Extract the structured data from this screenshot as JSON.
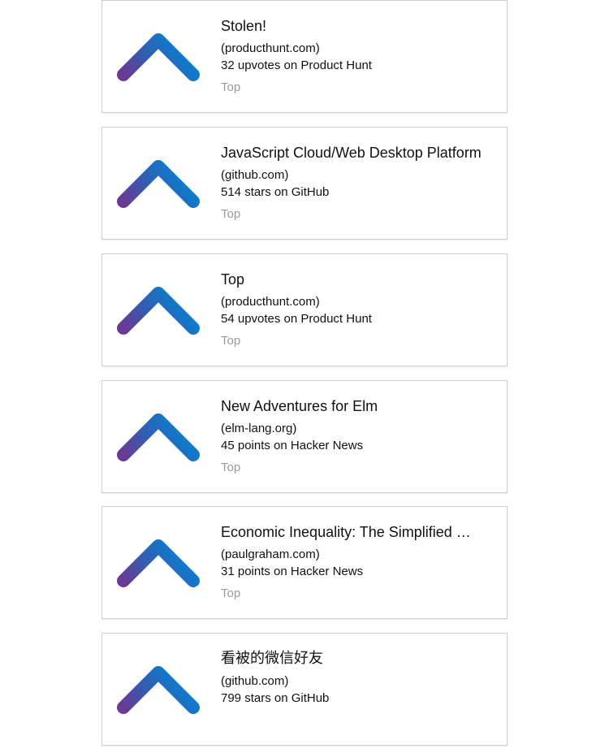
{
  "colors": {
    "arrow_start": "#6a3a94",
    "arrow_mid": "#2f5fb3",
    "arrow_end": "#0a7fd0",
    "card_border": "#cfcfcf",
    "tag_text": "#9a9a9a"
  },
  "icon": "upvote-chevron-icon",
  "items": [
    {
      "title": "Stolen!",
      "domain": "(producthunt.com)",
      "meta": "32 upvotes on Product Hunt",
      "tag": "Top"
    },
    {
      "title": "JavaScript Cloud/Web Desktop Platform",
      "domain": "(github.com)",
      "meta": "514 stars on GitHub",
      "tag": "Top"
    },
    {
      "title": "Top",
      "domain": "(producthunt.com)",
      "meta": "54 upvotes on Product Hunt",
      "tag": "Top"
    },
    {
      "title": "New Adventures for Elm",
      "domain": "(elm-lang.org)",
      "meta": "45 points on Hacker News",
      "tag": "Top"
    },
    {
      "title": "Economic Inequality: The Simplified …",
      "domain": "(paulgraham.com)",
      "meta": "31 points on Hacker News",
      "tag": "Top"
    },
    {
      "title": "看被的微信好友",
      "domain": "(github.com)",
      "meta": "799 stars on GitHub"
    }
  ]
}
